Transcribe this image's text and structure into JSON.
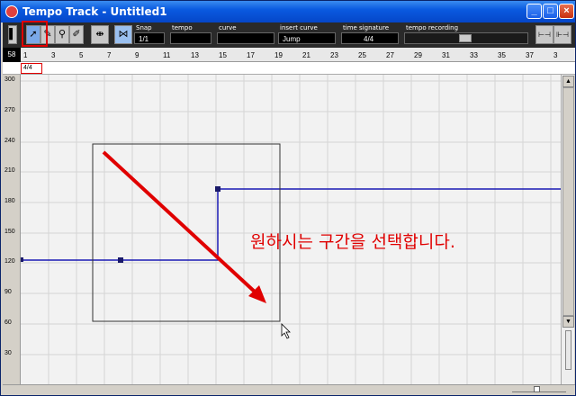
{
  "window": {
    "title": "Tempo Track - Untitled1",
    "controls": [
      "_",
      "□",
      "×"
    ]
  },
  "toolbar": {
    "snap": {
      "label": "Snap",
      "value": "1/1"
    },
    "tempo": {
      "label": "tempo",
      "value": ""
    },
    "curve": {
      "label": "curve",
      "value": ""
    },
    "insert_curve": {
      "label": "insert curve",
      "value": "Jump"
    },
    "time_signature": {
      "label": "time signature",
      "value": "4/4"
    },
    "tempo_recording": {
      "label": "tempo recording"
    }
  },
  "ruler": {
    "position": "58",
    "ticks": [
      "1",
      "3",
      "5",
      "7",
      "9",
      "11",
      "13",
      "15",
      "17",
      "19",
      "21",
      "23",
      "25",
      "27",
      "29",
      "31",
      "33",
      "35",
      "37",
      "3"
    ]
  },
  "signature_row": {
    "value": "4/4"
  },
  "y_axis": {
    "labels": [
      "300",
      "270",
      "240",
      "210",
      "180",
      "150",
      "120",
      "90",
      "60",
      "30"
    ]
  },
  "annotation": {
    "text": "원하시는 구간을 선택합니다.",
    "color": "#e00000"
  },
  "colors": {
    "tempo_line": "#1a1ab4",
    "highlight": "#e00000"
  }
}
